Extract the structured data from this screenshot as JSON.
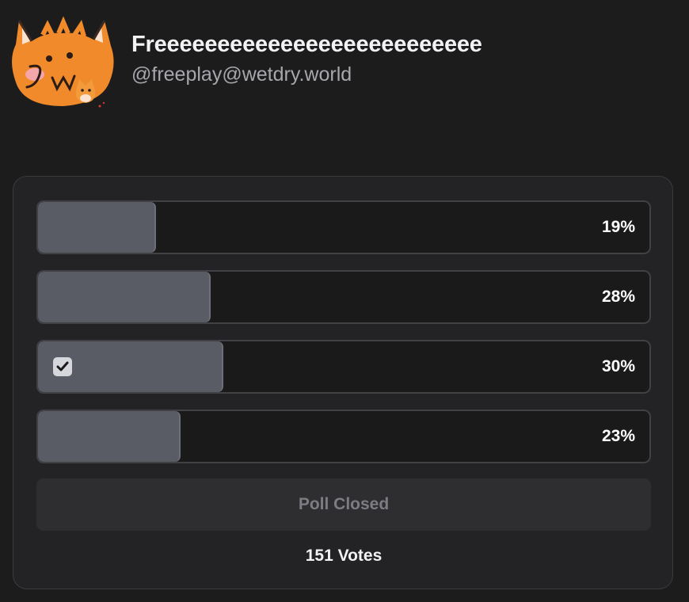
{
  "profile": {
    "display_name": "Freeeeeeeeeeeeeeeeeeeeeeeeee",
    "handle": "@freeplay@wetdry.world"
  },
  "poll": {
    "options": [
      {
        "percent_label": "19%",
        "share": 0.19,
        "selected": false
      },
      {
        "percent_label": "28%",
        "share": 0.28,
        "selected": false
      },
      {
        "percent_label": "30%",
        "share": 0.3,
        "selected": true
      },
      {
        "percent_label": "23%",
        "share": 0.23,
        "selected": false
      }
    ],
    "status_label": "Poll Closed",
    "vote_count": "151 Votes"
  },
  "colors": {
    "background": "#1c1c1d",
    "card": "#232325",
    "bar_fill": "#5a5c65",
    "text_primary": "#f2f2f4",
    "text_secondary": "#a6a6ad",
    "avatar_fox": "#f08a2a"
  }
}
